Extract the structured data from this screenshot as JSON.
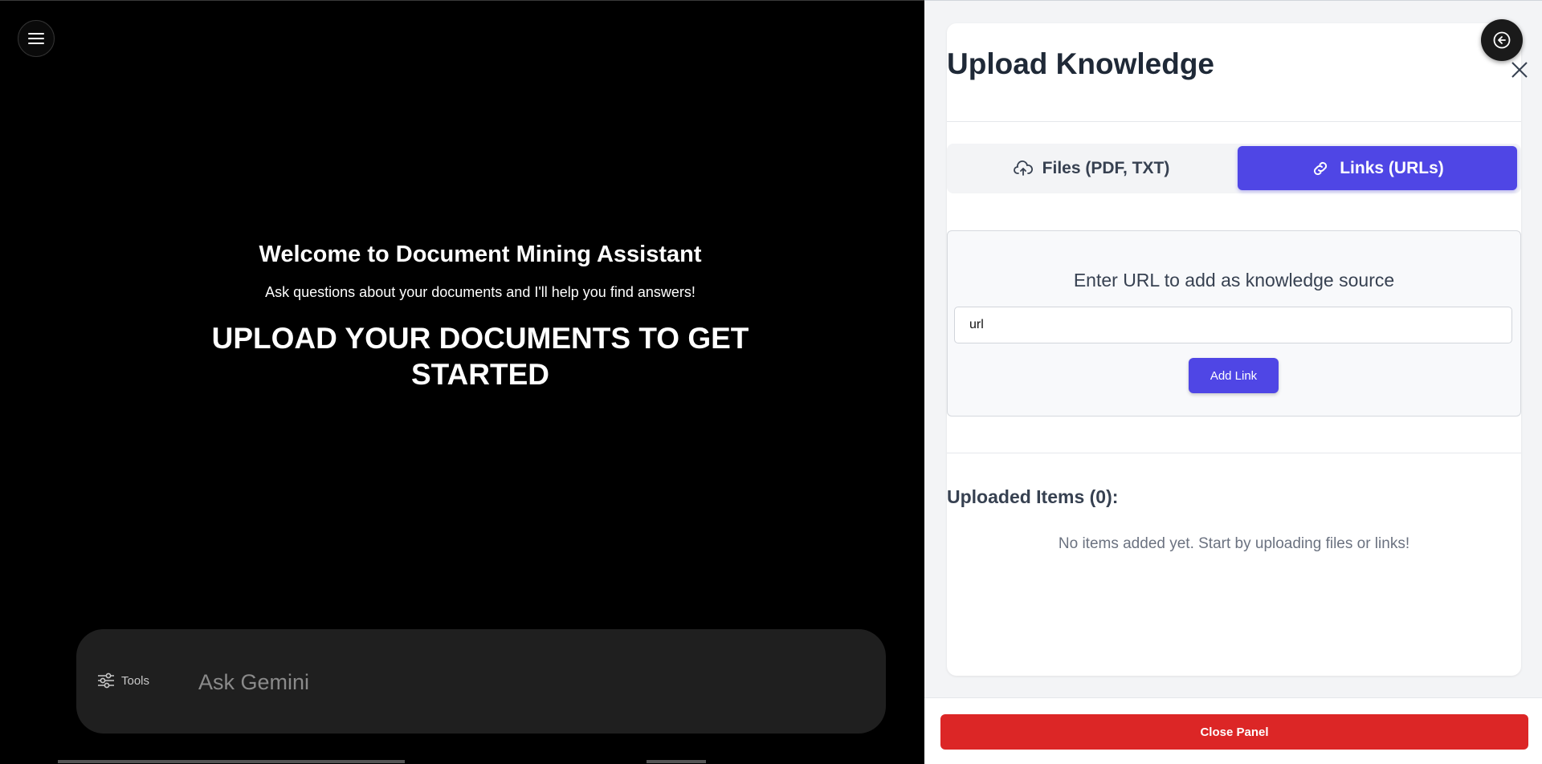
{
  "main": {
    "welcome_title": "Welcome to Document Mining Assistant",
    "welcome_subtitle": "Ask questions about your documents and I'll help you find answers!",
    "upload_cta": "UPLOAD YOUR DOCUMENTS TO GET STARTED",
    "chat": {
      "tools_label": "Tools",
      "placeholder": "Ask Gemini"
    }
  },
  "panel": {
    "title": "Upload Knowledge",
    "tabs": [
      {
        "label": "Files (PDF, TXT)",
        "active": false,
        "icon": "cloud-upload-icon"
      },
      {
        "label": "Links (URLs)",
        "active": true,
        "icon": "link-icon"
      }
    ],
    "url_section": {
      "label": "Enter URL to add as knowledge source",
      "input_value": "url",
      "add_button": "Add Link"
    },
    "uploaded_title": "Uploaded Items (0):",
    "empty_text": "No items added yet. Start by uploading files or links!",
    "close_button": "Close Panel"
  },
  "colors": {
    "accent": "#4f46e5",
    "danger": "#dc2626",
    "main_bg": "#000000",
    "panel_bg": "#f3f4f6"
  }
}
